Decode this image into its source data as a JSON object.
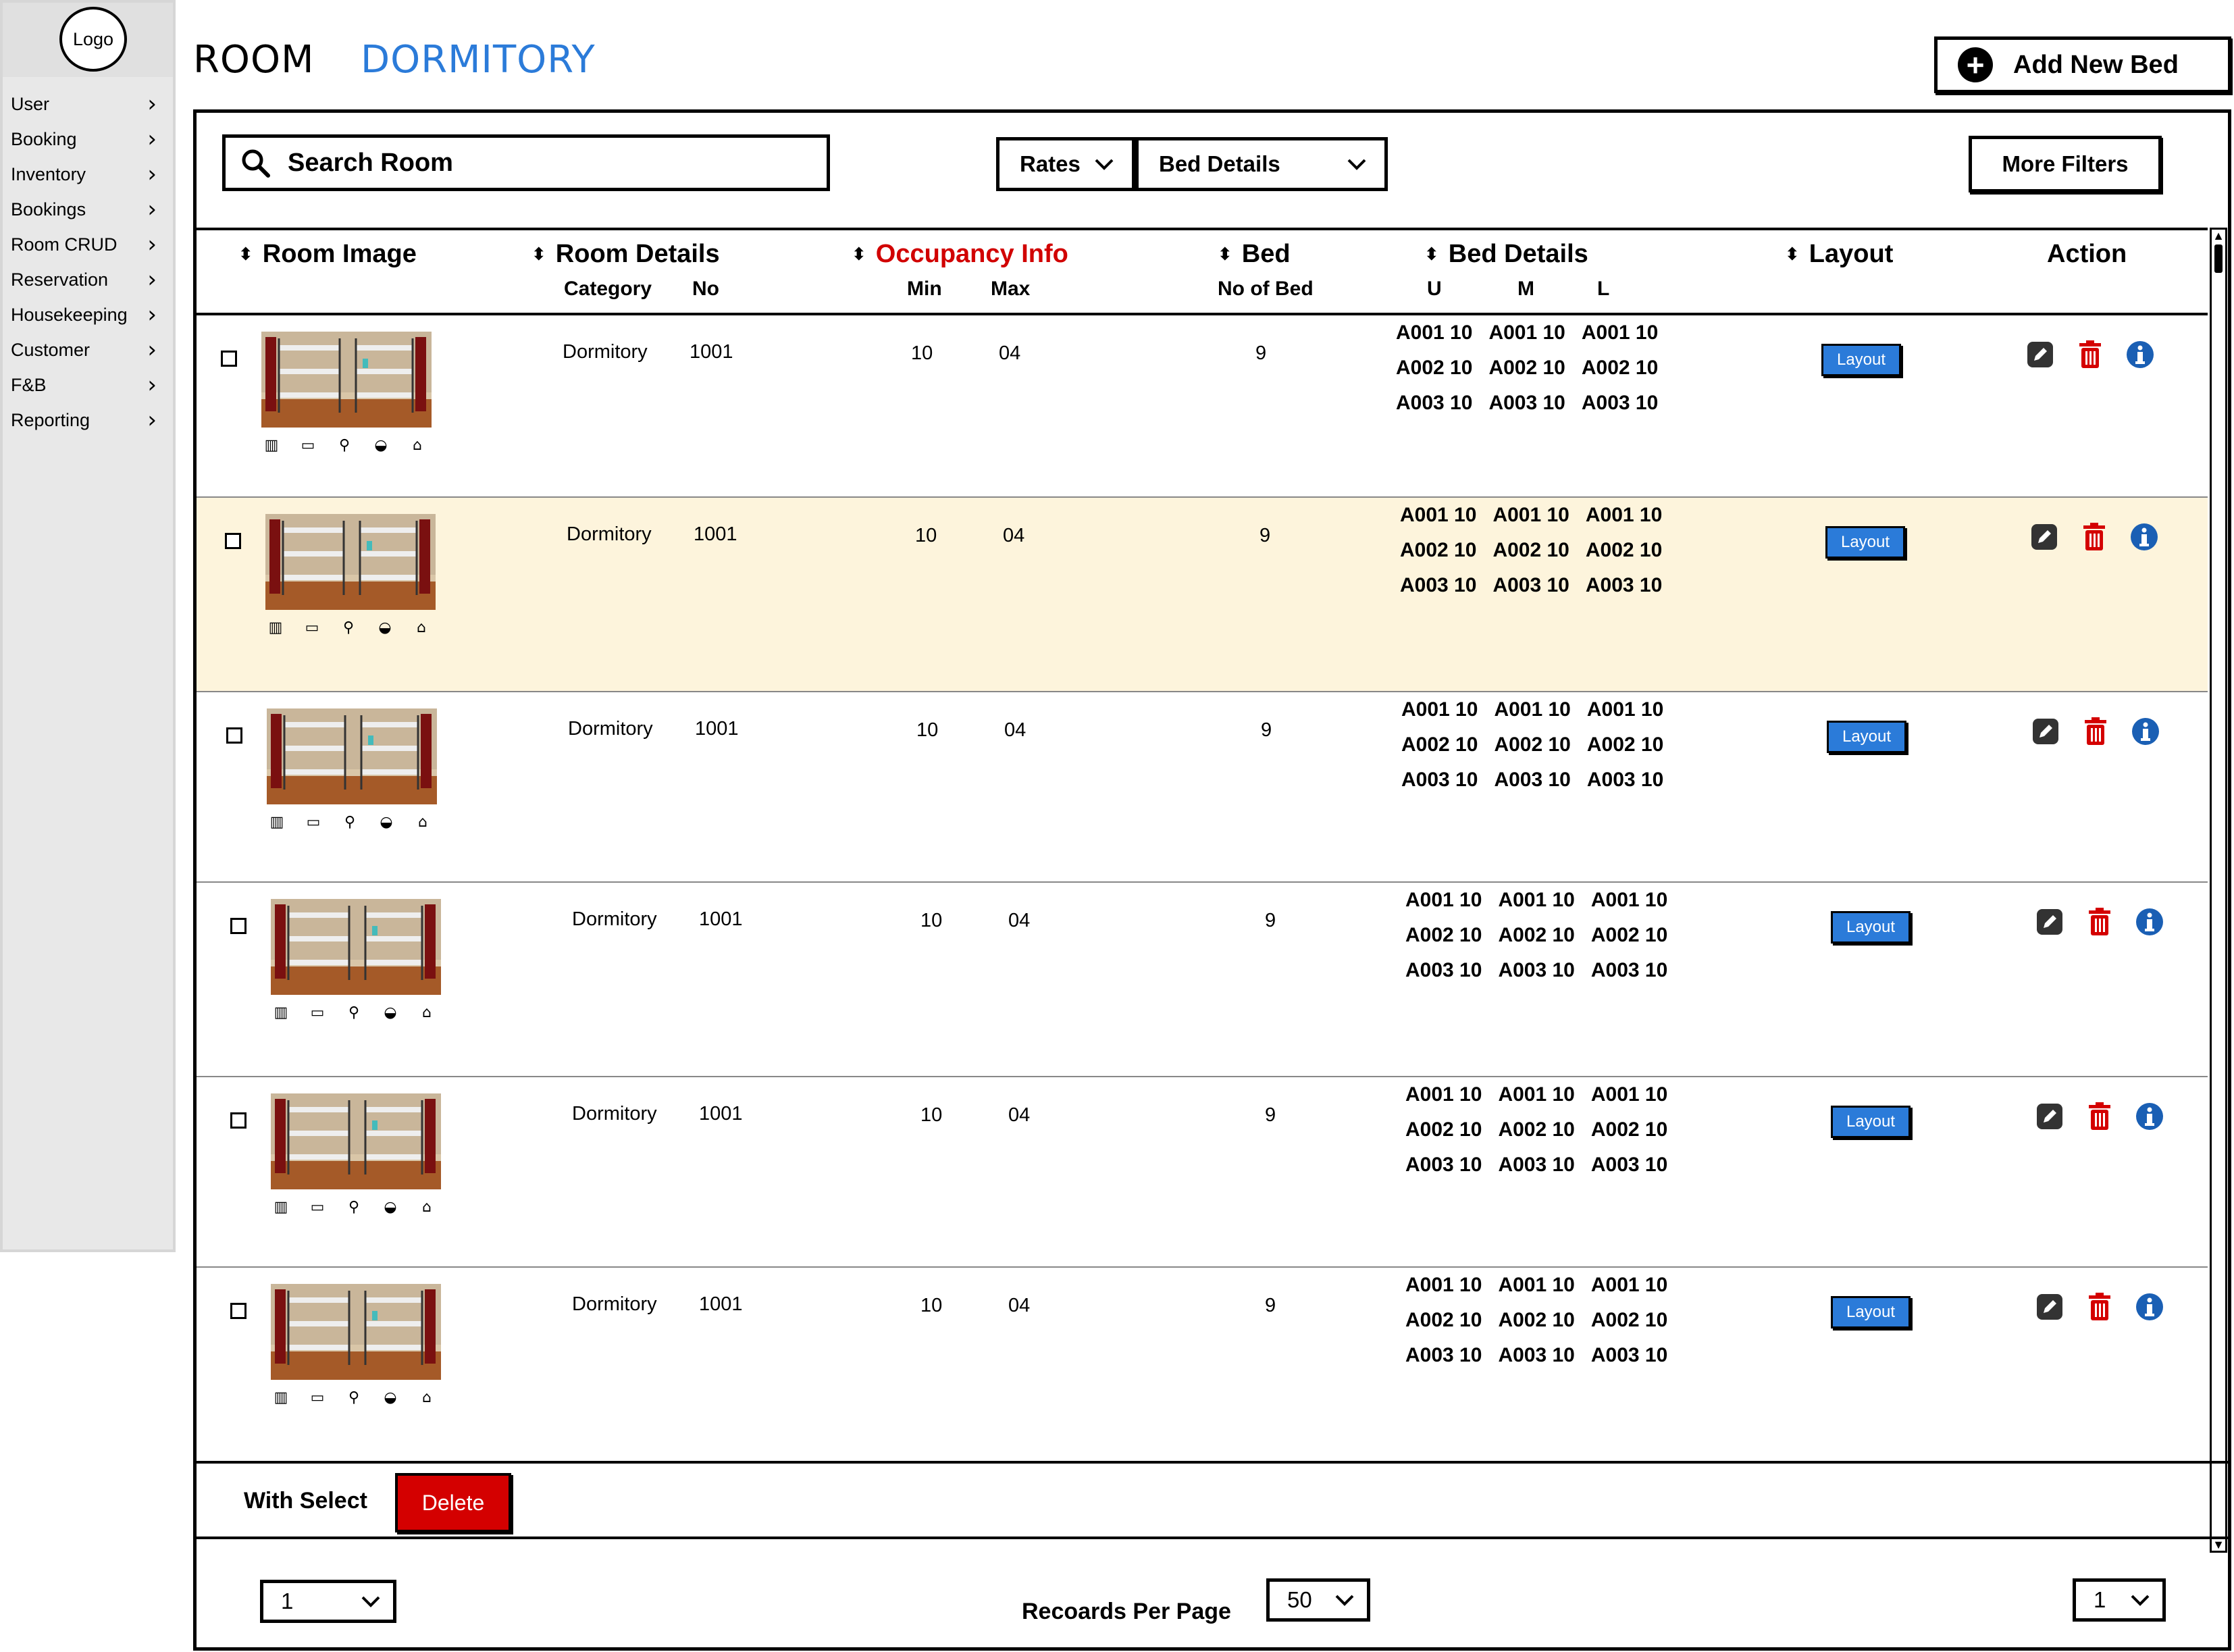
{
  "sidebar": {
    "logo": "Logo",
    "items": [
      {
        "label": "User"
      },
      {
        "label": "Booking"
      },
      {
        "label": "Inventory"
      },
      {
        "label": "Bookings"
      },
      {
        "label": "Room CRUD"
      },
      {
        "label": "Reservation"
      },
      {
        "label": "Housekeeping"
      },
      {
        "label": "Customer"
      },
      {
        "label": "F&B"
      },
      {
        "label": "Reporting"
      }
    ]
  },
  "header": {
    "room_label": "ROOM",
    "dormitory_label": "DORMITORY",
    "add_button": "Add New Bed"
  },
  "toolbar": {
    "search_placeholder": "Search Room",
    "rates_dropdown": "Rates",
    "bed_details_dropdown": "Bed Details",
    "more_filters": "More Filters"
  },
  "table": {
    "headers": {
      "room_image": "Room Image",
      "room_details": "Room Details",
      "category": "Category",
      "no": "No",
      "occupancy": "Occupancy Info",
      "min": "Min",
      "max": "Max",
      "bed": "Bed",
      "no_of_bed": "No of Bed",
      "bed_details": "Bed Details",
      "u": "U",
      "m": "M",
      "l": "L",
      "layout": "Layout",
      "action": "Action"
    },
    "rows": [
      {
        "category": "Dormitory",
        "no": "1001",
        "min": "10",
        "max": "04",
        "beds": "9",
        "layout": "Layout",
        "bed_lines": [
          [
            "A001 10",
            "A001 10",
            "A001 10"
          ],
          [
            "A002 10",
            "A002 10",
            "A002 10"
          ],
          [
            "A003 10",
            "A003 10",
            "A003 10"
          ]
        ]
      },
      {
        "category": "Dormitory",
        "no": "1001",
        "min": "10",
        "max": "04",
        "beds": "9",
        "layout": "Layout",
        "bed_lines": [
          [
            "A001 10",
            "A001 10",
            "A001 10"
          ],
          [
            "A002 10",
            "A002 10",
            "A002 10"
          ],
          [
            "A003 10",
            "A003 10",
            "A003 10"
          ]
        ]
      },
      {
        "category": "Dormitory",
        "no": "1001",
        "min": "10",
        "max": "04",
        "beds": "9",
        "layout": "Layout",
        "bed_lines": [
          [
            "A001 10",
            "A001 10",
            "A001 10"
          ],
          [
            "A002 10",
            "A002 10",
            "A002 10"
          ],
          [
            "A003 10",
            "A003 10",
            "A003 10"
          ]
        ]
      },
      {
        "category": "Dormitory",
        "no": "1001",
        "min": "10",
        "max": "04",
        "beds": "9",
        "layout": "Layout",
        "bed_lines": [
          [
            "A001 10",
            "A001 10",
            "A001 10"
          ],
          [
            "A002 10",
            "A002 10",
            "A002 10"
          ],
          [
            "A003 10",
            "A003 10",
            "A003 10"
          ]
        ]
      },
      {
        "category": "Dormitory",
        "no": "1001",
        "min": "10",
        "max": "04",
        "beds": "9",
        "layout": "Layout",
        "bed_lines": [
          [
            "A001 10",
            "A001 10",
            "A001 10"
          ],
          [
            "A002 10",
            "A002 10",
            "A002 10"
          ],
          [
            "A003 10",
            "A003 10",
            "A003 10"
          ]
        ]
      },
      {
        "category": "Dormitory",
        "no": "1001",
        "min": "10",
        "max": "04",
        "beds": "9",
        "layout": "Layout",
        "bed_lines": [
          [
            "A001 10",
            "A001 10",
            "A001 10"
          ],
          [
            "A002 10",
            "A002 10",
            "A002 10"
          ],
          [
            "A003 10",
            "A003 10",
            "A003 10"
          ]
        ]
      }
    ],
    "amenity_icons": [
      "wardrobe-icon",
      "air-conditioner-icon",
      "bicycle-icon",
      "food-icon",
      "hanger-icon"
    ]
  },
  "footer": {
    "with_select": "With Select",
    "delete": "Delete",
    "page_select_left": "1",
    "records_per_page_label": "Recoards Per Page",
    "records_per_page": "50",
    "page_select_right": "1"
  },
  "colors": {
    "accent_blue": "#2b7bd9",
    "danger_red": "#d40000",
    "highlight_row": "#fdf4dc",
    "info_blue": "#1a5fb4"
  }
}
